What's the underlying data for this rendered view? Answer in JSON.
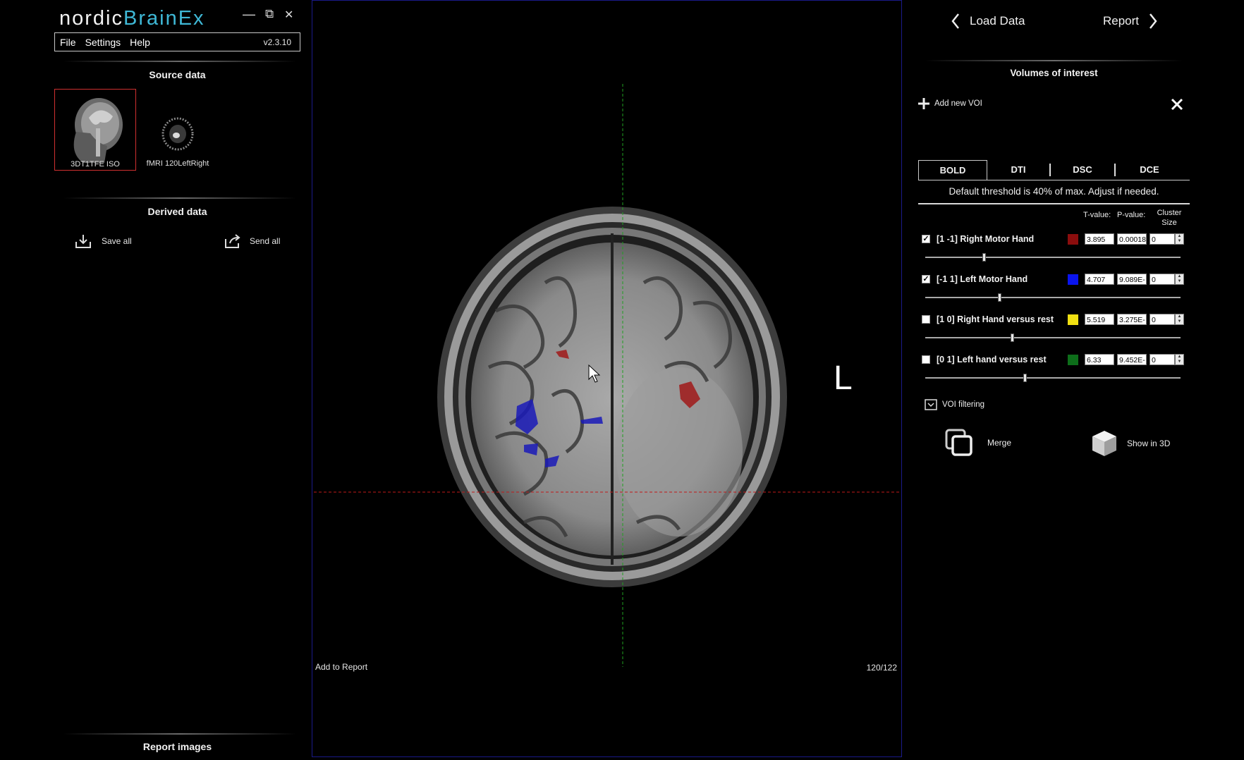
{
  "app": {
    "logo_part1": "nordic",
    "logo_part2": "BrainEx",
    "minimize": "—",
    "restore": "⧉",
    "close": "✕"
  },
  "menu": {
    "file": "File",
    "settings": "Settings",
    "help": "Help",
    "version": "v2.3.10"
  },
  "left": {
    "source_title": "Source data",
    "source_items": [
      {
        "label": "3DT1TFE ISO"
      },
      {
        "label": "fMRI 120LeftRight"
      }
    ],
    "derived_title": "Derived data",
    "save_all": "Save all",
    "send_all": "Send all",
    "report_images": "Report images"
  },
  "viewer": {
    "orientation": "L",
    "add_to_report": "Add to Report",
    "slice": "120/122"
  },
  "right": {
    "load_data": "Load Data",
    "report": "Report",
    "voi_title": "Volumes of interest",
    "add_voi": "Add new VOI",
    "tabs": [
      "BOLD",
      "DTI",
      "DSC",
      "DCE"
    ],
    "threshold_note": "Default threshold is 40% of max. Adjust if needed.",
    "col_t": "T-value:",
    "col_p": "P-value:",
    "col_cluster": "Cluster",
    "col_size": "Size",
    "vois": [
      {
        "checked": true,
        "label": "[1 -1] Right Motor Hand",
        "color": "#8b0d0d",
        "t": "3.895",
        "p": "0.00018",
        "cluster": "0",
        "level": 0.23
      },
      {
        "checked": true,
        "label": "[-1 1] Left Motor Hand",
        "color": "#0a14ee",
        "t": "4.707",
        "p": "9.089E-",
        "cluster": "0",
        "level": 0.29
      },
      {
        "checked": false,
        "label": "[1 0]  Right Hand versus rest",
        "color": "#f0e012",
        "t": "5.519",
        "p": "3.275E-",
        "cluster": "0",
        "level": 0.34
      },
      {
        "checked": false,
        "label": "[0 1]  Left hand versus rest",
        "color": "#0d6e1a",
        "t": "6.33",
        "p": "9.452E-",
        "cluster": "0",
        "level": 0.39
      }
    ],
    "voi_filtering": "VOI filtering",
    "merge": "Merge",
    "show_3d": "Show in 3D"
  }
}
